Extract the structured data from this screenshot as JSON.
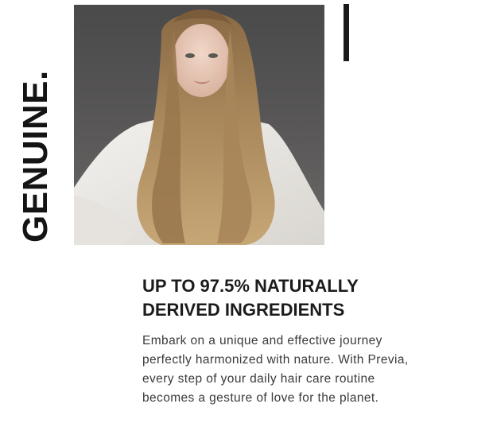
{
  "brand_word": "GENUINE.",
  "photo": {
    "description_icon": "portrait-photo"
  },
  "headline": {
    "line1": "UP TO 97.5% NATURALLY",
    "line2": "DERIVED INGREDIENTS"
  },
  "body": {
    "line1": "Embark on a unique and effective journey",
    "line2": "perfectly harmonized with nature. With Previa,",
    "line3": "every step of your daily hair care routine",
    "line4": "becomes a gesture of love for the planet."
  },
  "colors": {
    "text_dark": "#1b1b1b",
    "accent_bar": "#1a1a1a",
    "background": "#ffffff"
  }
}
